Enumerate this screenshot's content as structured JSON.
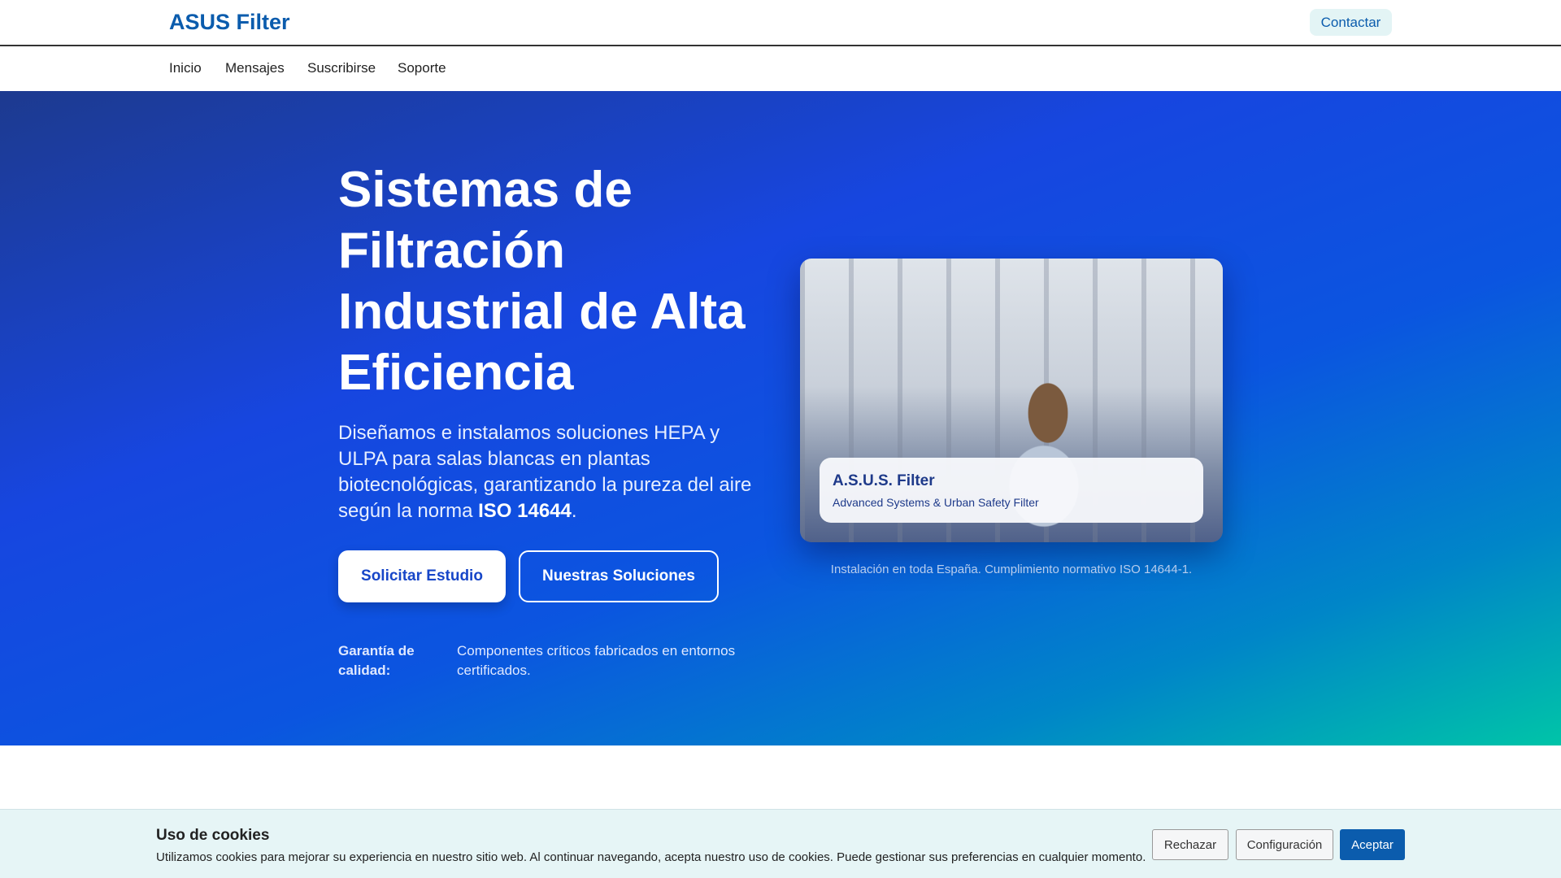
{
  "header": {
    "logo": "ASUS Filter",
    "contact_label": "Contactar"
  },
  "nav": {
    "items": [
      "Inicio",
      "Mensajes",
      "Suscribirse",
      "Soporte"
    ]
  },
  "hero": {
    "title": "Sistemas de Filtración Industrial de Alta Eficiencia",
    "lead_text": "Diseñamos e instalamos soluciones HEPA y ULPA para salas blancas en plantas biotecnológicas, garantizando la pureza del aire según la norma ",
    "lead_strong": "ISO 14644",
    "lead_end": ".",
    "primary_button": "Solicitar Estudio",
    "secondary_button": "Nuestras Soluciones",
    "guarantee_label": "Garantía de calidad:",
    "guarantee_value": "Componentes críticos fabricados en entornos certificados.",
    "card": {
      "title": "A.S.U.S. Filter",
      "subtitle": "Advanced Systems & Urban Safety Filter"
    },
    "caption": "Instalación en toda España. Cumplimiento normativo ISO 14644-1."
  },
  "cookie": {
    "title": "Uso de cookies",
    "text": "Utilizamos cookies para mejorar su experiencia en nuestro sitio web. Al continuar navegando, acepta nuestro uso de cookies. Puede gestionar sus preferencias en cualquier momento.",
    "reject": "Rechazar",
    "settings": "Configuración",
    "accept": "Aceptar"
  }
}
